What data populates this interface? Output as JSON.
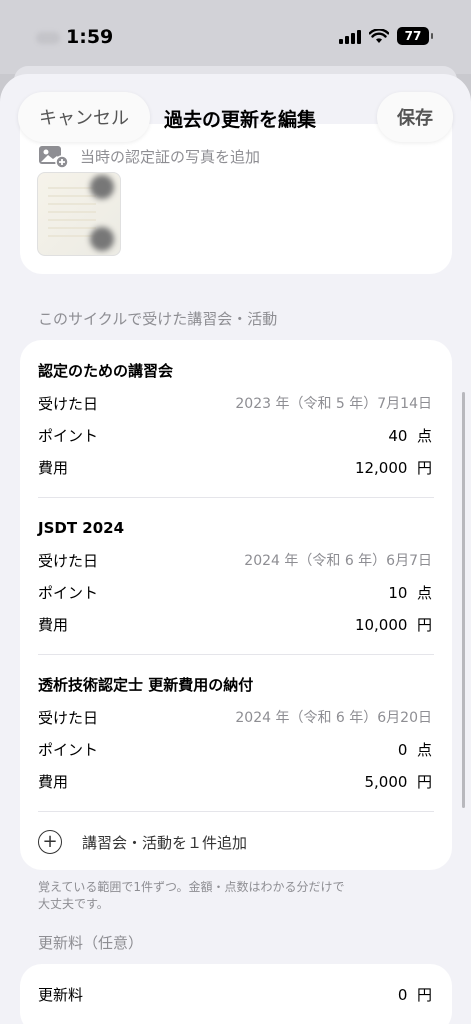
{
  "status_bar": {
    "time": "1:59",
    "battery": "77"
  },
  "nav": {
    "cancel_label": "キャンセル",
    "title": "過去の更新を編集",
    "save_label": "保存"
  },
  "photo": {
    "add_label": "当時の認定証の写真を追加"
  },
  "activities_section": {
    "header": "このサイクルで受けた講習会・活動"
  },
  "activities": [
    {
      "title": "認定のための講習会",
      "date_label": "受けた日",
      "date": "2023 年（令和 5 年）7月14日",
      "points_label": "ポイント",
      "points": "40",
      "points_unit": "点",
      "cost_label": "費用",
      "cost": "12,000",
      "cost_unit": "円"
    },
    {
      "title": "JSDT 2024",
      "date_label": "受けた日",
      "date": "2024 年（令和 6 年）6月7日",
      "points_label": "ポイント",
      "points": "10",
      "points_unit": "点",
      "cost_label": "費用",
      "cost": "10,000",
      "cost_unit": "円"
    },
    {
      "title": "透析技術認定士 更新費用の納付",
      "date_label": "受けた日",
      "date": "2024 年（令和 6 年）6月20日",
      "points_label": "ポイント",
      "points": "0",
      "points_unit": "点",
      "cost_label": "費用",
      "cost": "5,000",
      "cost_unit": "円"
    }
  ],
  "add_activity_label": "講習会・活動を１件追加",
  "footnote_line1": "覚えている範囲で1件ずつ。金額・点数はわかる分だけで",
  "footnote_line2": "大丈夫です。",
  "renewal_section": {
    "header": "更新料（任意）",
    "label": "更新料",
    "value": "0",
    "unit": "円"
  }
}
